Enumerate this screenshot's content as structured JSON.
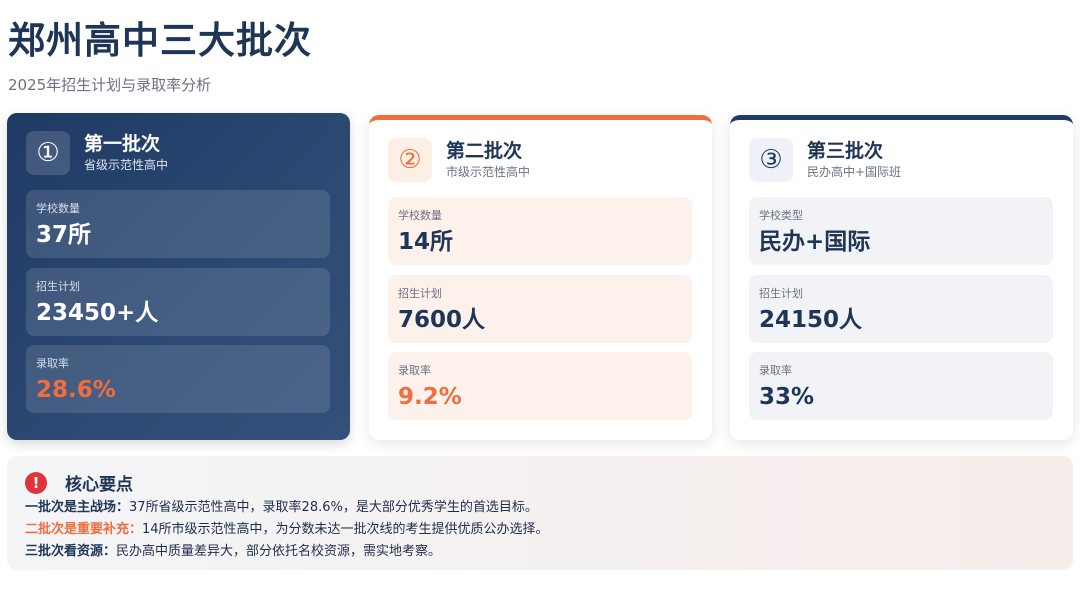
{
  "header": {
    "title": "郑州高中三大批次",
    "subtitle": "2025年招生计划与录取率分析"
  },
  "cards": [
    {
      "number": "①",
      "title": "第一批次",
      "subtitle": "省级示范性高中",
      "stats": [
        {
          "label": "学校数量",
          "value": "37所"
        },
        {
          "label": "招生计划",
          "value": "23450+人"
        },
        {
          "label": "录取率",
          "value": "28.6%"
        }
      ]
    },
    {
      "number": "②",
      "title": "第二批次",
      "subtitle": "市级示范性高中",
      "stats": [
        {
          "label": "学校数量",
          "value": "14所"
        },
        {
          "label": "招生计划",
          "value": "7600人"
        },
        {
          "label": "录取率",
          "value": "9.2%"
        }
      ]
    },
    {
      "number": "③",
      "title": "第三批次",
      "subtitle": "民办高中+国际班",
      "stats": [
        {
          "label": "学校类型",
          "value": "民办+国际"
        },
        {
          "label": "招生计划",
          "value": "24150人"
        },
        {
          "label": "录取率",
          "value": "33%"
        }
      ]
    }
  ],
  "notes": {
    "icon": "!",
    "title": "核心要点",
    "lines": [
      {
        "key": "一批次是主战场：",
        "text": "37所省级示范性高中，录取率28.6%，是大部分优秀学生的首选目标。"
      },
      {
        "key": "二批次是重要补充：",
        "text": "14所市级示范性高中，为分数未达一批次线的考生提供优质公办选择。"
      },
      {
        "key": "三批次看资源：",
        "text": "民办高中质量差异大，部分依托名校资源，需实地考察。"
      }
    ]
  },
  "colors": {
    "navy": "#1f3a64",
    "orange": "#f26d3d",
    "alert_red": "#e0343b"
  }
}
